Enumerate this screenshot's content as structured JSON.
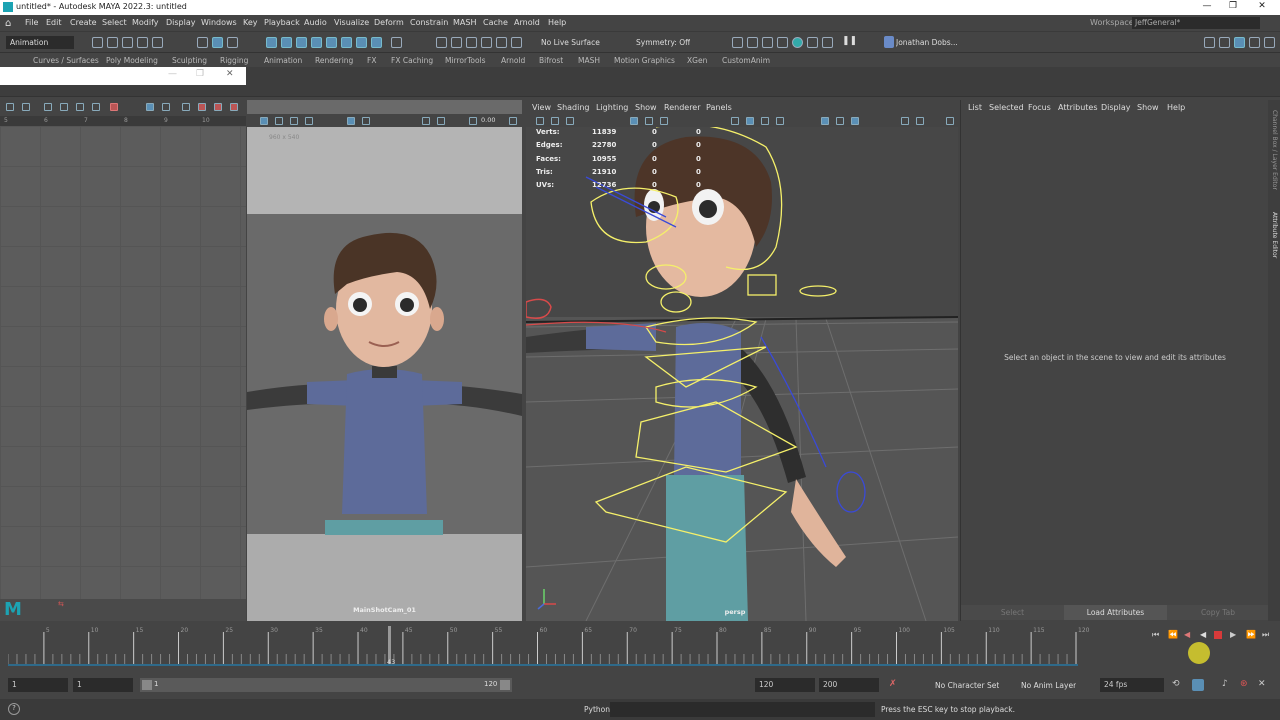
{
  "window": {
    "title": "untitled* - Autodesk MAYA 2022.3: untitled",
    "workspace_label": "Workspace:",
    "workspace_value": "JeffGeneral*"
  },
  "menus": [
    "File",
    "Edit",
    "Create",
    "Select",
    "Modify",
    "Display",
    "Windows",
    "Key",
    "Playback",
    "Audio",
    "Visualize",
    "Deform",
    "Constrain",
    "MASH",
    "Cache",
    "Arnold",
    "Help"
  ],
  "toolbar": {
    "mode": "Animation",
    "live_surface": "No Live Surface",
    "symmetry": "Symmetry: Off",
    "user": "Jonathan Dobs..."
  },
  "shelf_tabs": [
    "Curves / Surfaces",
    "Poly Modeling",
    "Sculpting",
    "Rigging",
    "Animation",
    "Rendering",
    "FX",
    "FX Caching",
    "MirrorTools",
    "Arnold",
    "Bifrost",
    "MASH",
    "Motion Graphics",
    "XGen",
    "CustomAnim"
  ],
  "graph_ruler": [
    "5",
    "6",
    "7",
    "8",
    "9",
    "10"
  ],
  "left_viewport": {
    "resolution": "960 x 540",
    "camera": "MainShotCam_01",
    "value": "0.00"
  },
  "right_viewport": {
    "menus": [
      "View",
      "Shading",
      "Lighting",
      "Show",
      "Renderer",
      "Panels"
    ],
    "camera": "persp",
    "stats": [
      {
        "label": "Verts:",
        "value": "11839",
        "a": "0",
        "b": "0"
      },
      {
        "label": "Edges:",
        "value": "22780",
        "a": "0",
        "b": "0"
      },
      {
        "label": "Faces:",
        "value": "10955",
        "a": "0",
        "b": "0"
      },
      {
        "label": "Tris:",
        "value": "21910",
        "a": "0",
        "b": "0"
      },
      {
        "label": "UVs:",
        "value": "12736",
        "a": "0",
        "b": "0"
      }
    ]
  },
  "attribute_editor": {
    "menus": [
      "List",
      "Selected",
      "Focus",
      "Attributes",
      "Display",
      "Show",
      "Help"
    ],
    "message": "Select an object in the scene to view and edit its attributes",
    "select_btn": "Select",
    "load_btn": "Load Attributes",
    "copy_btn": "Copy Tab",
    "side_tabs": [
      "Channel Box / Layer Editor",
      "Attribute Editor"
    ]
  },
  "timeline": {
    "ticks": [
      "5",
      "10",
      "15",
      "20",
      "25",
      "30",
      "35",
      "40",
      "45",
      "50",
      "55",
      "60",
      "65",
      "70",
      "75",
      "80",
      "85",
      "90",
      "95",
      "100",
      "105",
      "110",
      "115",
      "120"
    ],
    "current_frame": "43"
  },
  "range": {
    "start": "1",
    "start2": "1",
    "slider_start": "1",
    "slider_end": "120",
    "end": "120",
    "end2": "200",
    "character_set": "No Character Set",
    "anim_layer": "No Anim Layer",
    "fps": "24 fps"
  },
  "command": {
    "lang": "Python",
    "help": "Press the ESC key to stop playback."
  }
}
